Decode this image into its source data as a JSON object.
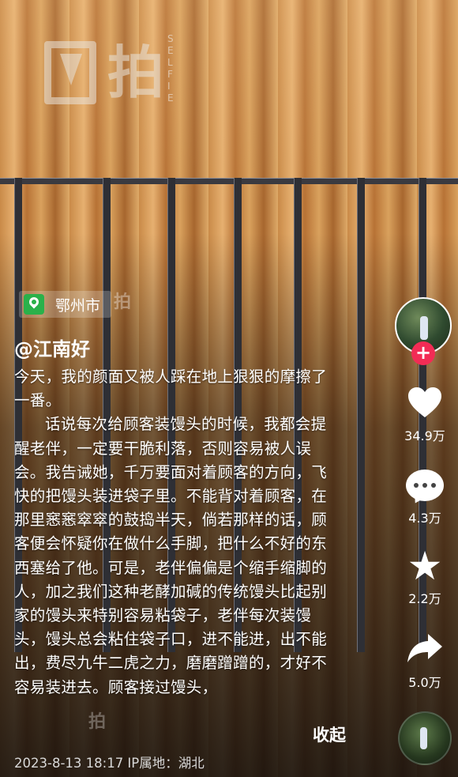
{
  "watermark": {
    "brand": "拍",
    "vertical": "SELFIE",
    "small": "拍"
  },
  "location": {
    "label": "鄂州市"
  },
  "author": "@江南好",
  "caption": {
    "line1": "今天，我的颜面又被人踩在地上狠狠的摩擦了一番。",
    "para2": "话说每次给顾客装馒头的时候，我都会提醒老伴，一定要干脆利落，否则容易被人误会。我告诫她，千万要面对着顾客的方向，飞快的把馒头装进袋子里。不能背对着顾客，在那里窸窸窣窣的鼓捣半天，倘若那样的话，顾客便会怀疑你在做什么手脚，把什么不好的东西塞给了他。可是，老伴偏偏是个缩手缩脚的人，加之我们这种老酵加碱的传统馒头比起别家的馒头来特别容易粘袋子，老伴每次装馒头，馒头总会粘住袋子口，进不能进，出不能出，费尽九牛二虎之力，磨磨蹭蹭的，才好不容易装进去。顾客接过馒头，"
  },
  "collapse_label": "收起",
  "meta": "2023-8-13 18:17  IP属地：湖北",
  "actions": {
    "like_count": "34.9万",
    "comment_count": "4.3万",
    "favorite_count": "2.2万",
    "share_count": "5.0万"
  },
  "colors": {
    "follow": "#f22c55",
    "location_pin": "#2ab14a"
  }
}
